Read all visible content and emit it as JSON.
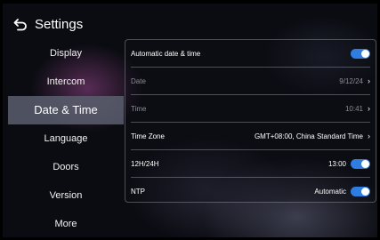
{
  "header": {
    "title": "Settings",
    "back_icon": "back-arrow-icon"
  },
  "sidebar": {
    "items": [
      {
        "label": "Display"
      },
      {
        "label": "Intercom"
      },
      {
        "label": "Date & Time",
        "active": true
      },
      {
        "label": "Language"
      },
      {
        "label": "Doors"
      },
      {
        "label": "Version"
      },
      {
        "label": "More"
      }
    ]
  },
  "settings": {
    "automatic_date_time": {
      "label": "Automatic date & time",
      "enabled": true
    },
    "date": {
      "label": "Date",
      "value": "9/12/24"
    },
    "time": {
      "label": "Time",
      "value": "10:41"
    },
    "time_zone": {
      "label": "Time Zone",
      "value": "GMT+08:00, China Standard Time"
    },
    "hour_format": {
      "label": "12H/24H",
      "value": "13:00",
      "enabled": true
    },
    "ntp": {
      "label": "NTP",
      "value": "Automatic",
      "enabled": true
    }
  },
  "colors": {
    "accent": "#2e7de0",
    "active_nav_bg": "#5a5f6e"
  }
}
